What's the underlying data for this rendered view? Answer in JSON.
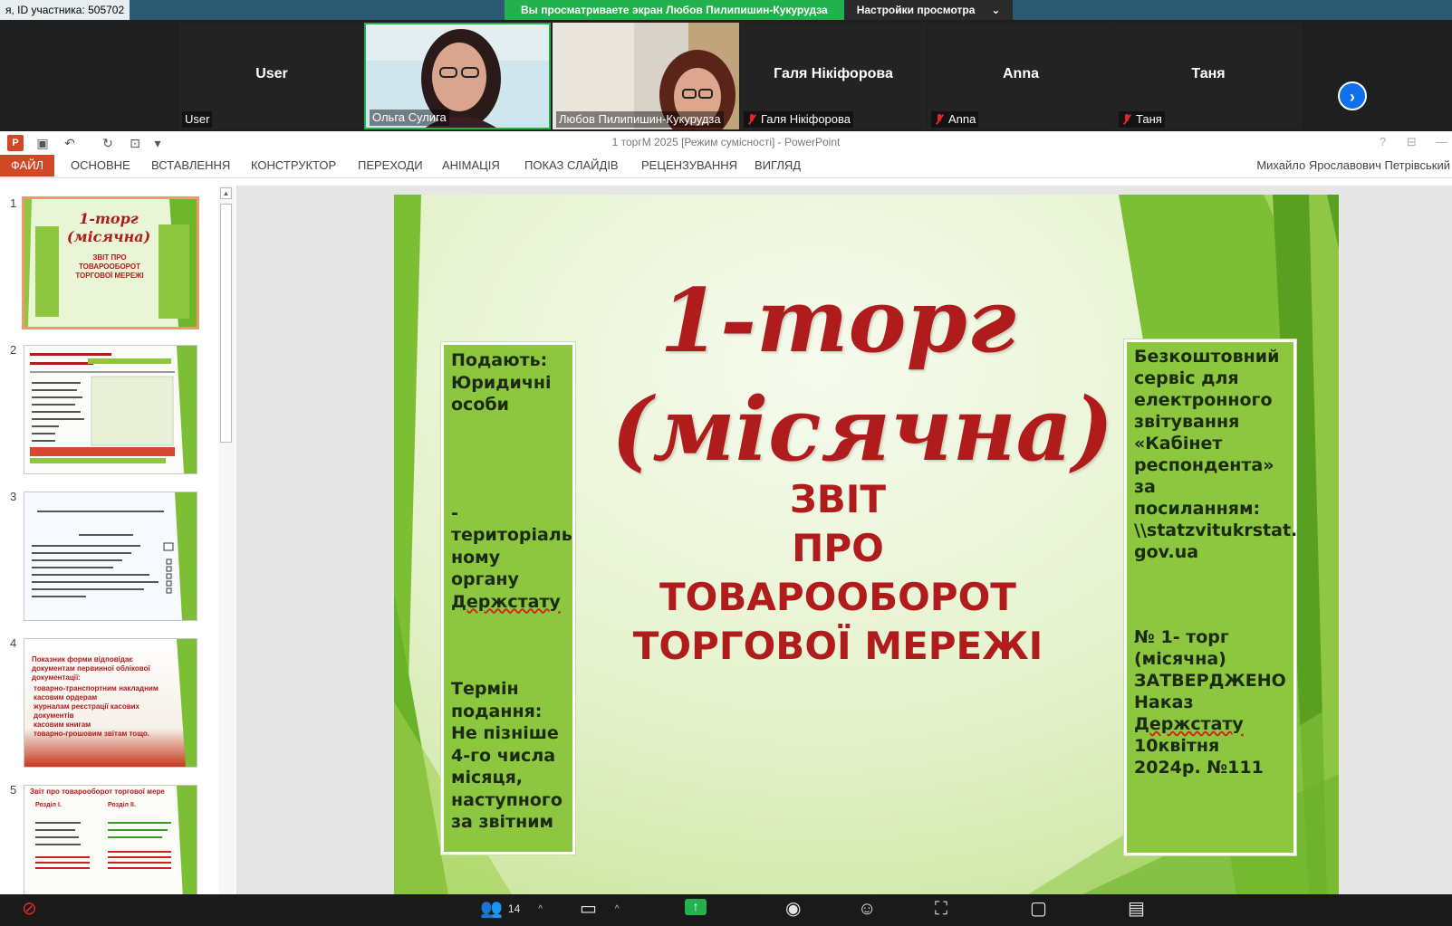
{
  "zoom": {
    "meeting_id_text": "я, ID участника: 505702",
    "share_banner": "Вы просматриваете экран Любов Пилипишин-Кукурудза",
    "view_options": "Настройки просмотра",
    "participants": [
      {
        "center_name": "User",
        "label": "User",
        "muted": false,
        "video": false
      },
      {
        "center_name": "",
        "label": "Ольга Сулига",
        "muted": false,
        "video": true
      },
      {
        "center_name": "",
        "label": "Любов Пилипишин-Кукурудза",
        "muted": false,
        "video": true
      },
      {
        "center_name": "Галя Нікіфорова",
        "label": "Галя Нікіфорова",
        "muted": true,
        "video": false
      },
      {
        "center_name": "Anna",
        "label": "Anna",
        "muted": true,
        "video": false
      },
      {
        "center_name": "Таня",
        "label": "Таня",
        "muted": true,
        "video": false
      }
    ],
    "participant_count": "14",
    "accent_green": "#23b14d",
    "accent_blue": "#0e71eb"
  },
  "ppt": {
    "window_title": "1 торгМ 2025 [Режим сумісності] - PowerPoint",
    "tabs": [
      "ФАЙЛ",
      "ОСНОВНЕ",
      "ВСТАВЛЕННЯ",
      "КОНСТРУКТОР",
      "ПЕРЕХОДИ",
      "АНІМАЦІЯ",
      "ПОКАЗ СЛАЙДІВ",
      "РЕЦЕНЗУВАННЯ",
      "ВИГЛЯД"
    ],
    "user_name": "Михайло Ярославович Петрівський",
    "thumb_numbers": [
      "1",
      "2",
      "3",
      "4",
      "5"
    ],
    "thumbs": {
      "t1_title": "1-торг (місячна)",
      "t1_sub": "ЗВІТ ПРО ТОВАРООБОРОТ ТОРГОВОЇ МЕРЕЖІ",
      "t4_heading": "Показник форми відповідає документам первинної облікової документації:",
      "t4_items": [
        "товарно-транспортним накладним",
        "касовим ордерам",
        "журналам реєстрації касових документів",
        "касовим книгам",
        "товарно-грошовим звітам тощо."
      ],
      "t5_title": "Звіт про товарооборот торгової мере",
      "t5_col1": "Розділ І.",
      "t5_col2": "Розділ ІІ."
    },
    "slide": {
      "title_line1": "1-торг",
      "title_line2": "(місячна)",
      "sub1": "ЗВІТ",
      "sub2": "ПРО",
      "sub3": "ТОВАРООБОРОТ",
      "sub4": "ТОРГОВОЇ МЕРЕЖІ",
      "left": {
        "p1": "Подають: Юридичні особи",
        "p2a": "- територіаль ному органу ",
        "p2b": "Держстату",
        "p3": "Термін подання: Не пізніше 4-го числа місяця, наступного за звітним"
      },
      "right": {
        "p1": "Безкоштовний сервіс для електронного звітування «Кабінет респондента»  за посиланням: \\\\statzvitukrstat. gov.ua",
        "p2a": "№ 1- торг (місячна) ЗАТВЕРДЖЕНО Наказ ",
        "p2b": "Держстату",
        "p2c": " 10квітня 2024р. №111"
      },
      "title_color": "#b01c1c",
      "box_color": "#8dc63f"
    }
  }
}
